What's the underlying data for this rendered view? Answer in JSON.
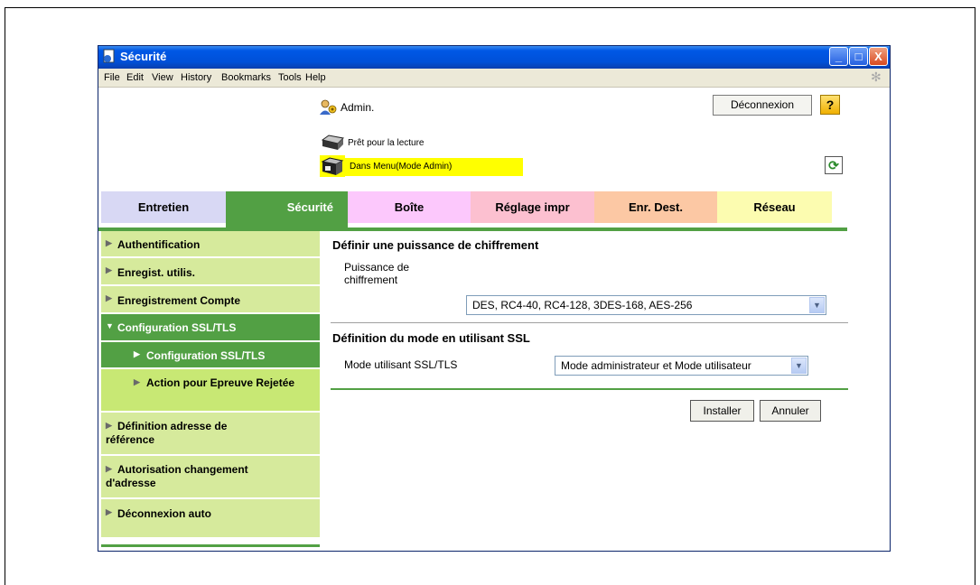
{
  "window": {
    "title": "Sécurité",
    "controls": {
      "minimize": "_",
      "maximize": "□",
      "close": "X"
    }
  },
  "menubar": {
    "items": [
      "File",
      "Edit",
      "View",
      "History",
      "Bookmarks",
      "Tools",
      "Help"
    ]
  },
  "header": {
    "user_label": "Admin.",
    "logout_label": "Déconnexion",
    "help_label": "?",
    "status_ready": "Prêt pour la lecture",
    "status_mode": "Dans Menu(Mode Admin)"
  },
  "tabs": [
    {
      "label": "Entretien",
      "color": "#d8d8f4"
    },
    {
      "label": "Sécurité",
      "color": "#52a044",
      "active": true
    },
    {
      "label": "Boîte",
      "color": "#fcc8fc"
    },
    {
      "label": "Réglage impr",
      "color": "#fcc0d0"
    },
    {
      "label": "Enr. Dest.",
      "color": "#fcc8a4"
    },
    {
      "label": "Réseau",
      "color": "#fcfcb0"
    }
  ],
  "sidebar": {
    "items": [
      {
        "label": "Authentification"
      },
      {
        "label": "Enregist. utilis."
      },
      {
        "label": "Enregistrement Compte"
      },
      {
        "label": "Configuration SSL/TLS",
        "expanded": true
      },
      {
        "label": "Configuration SSL/TLS",
        "sub": true,
        "selected": true
      },
      {
        "label": "Action pour Epreuve Rejetée",
        "sub": true
      },
      {
        "label": "Définition adresse de référence"
      },
      {
        "label": "Autorisation changement d'adresse"
      },
      {
        "label": "Déconnexion auto"
      }
    ]
  },
  "main": {
    "section1_title": "Définir une puissance de chiffrement",
    "encryption_label": "Puissance de chiffrement",
    "encryption_value": "DES, RC4-40, RC4-128, 3DES-168, AES-256",
    "section2_title": "Définition du mode en utilisant SSL",
    "ssl_mode_label": "Mode utilisant SSL/TLS",
    "ssl_mode_value": "Mode administrateur et Mode utilisateur",
    "install_label": "Installer",
    "cancel_label": "Annuler"
  }
}
